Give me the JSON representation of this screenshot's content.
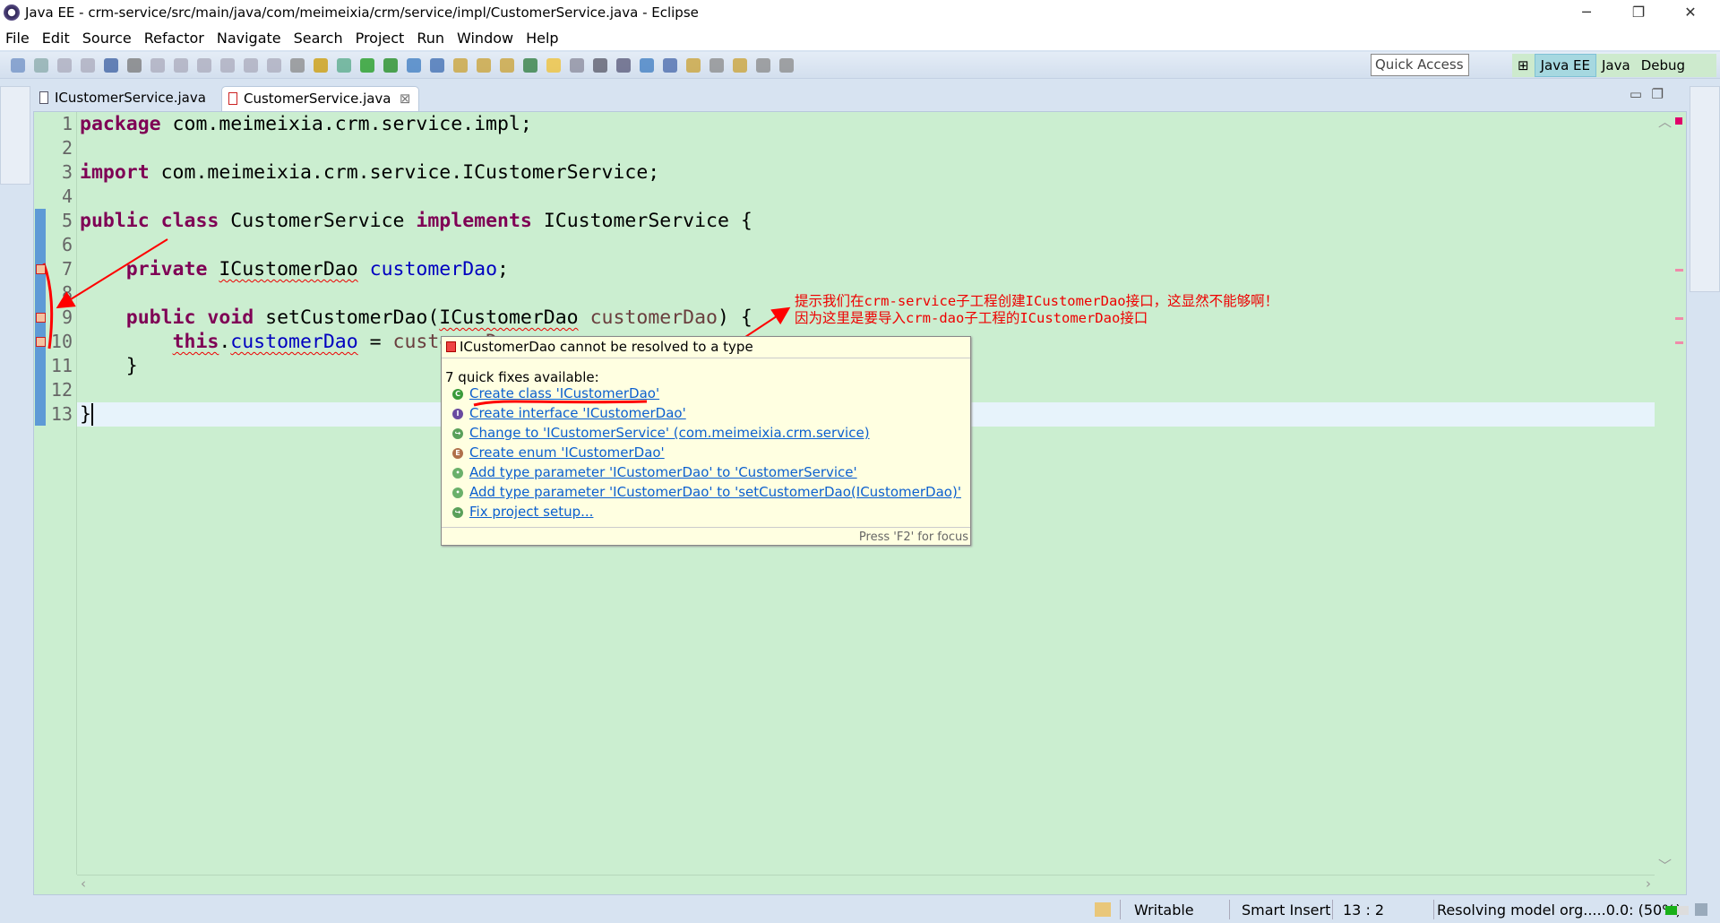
{
  "window": {
    "title": "Java EE - crm-service/src/main/java/com/meimeixia/crm/service/impl/CustomerService.java - Eclipse"
  },
  "menu": [
    "File",
    "Edit",
    "Source",
    "Refactor",
    "Navigate",
    "Search",
    "Project",
    "Run",
    "Window",
    "Help"
  ],
  "toolbar": {
    "quick_access_placeholder": "Quick Access"
  },
  "perspectives": [
    {
      "label": "Java EE",
      "active": true
    },
    {
      "label": "Java",
      "active": false
    },
    {
      "label": "Debug",
      "active": false
    }
  ],
  "tabs": [
    {
      "label": "ICustomerService.java",
      "active": false
    },
    {
      "label": "CustomerService.java",
      "active": true,
      "has_error": true
    }
  ],
  "editor": {
    "current_line": 13,
    "error_lines": [
      7,
      9,
      10
    ],
    "lines": [
      [
        [
          "package",
          "kw"
        ],
        [
          " com.meimeixia.crm.service.impl;",
          ""
        ]
      ],
      [],
      [
        [
          "import",
          "kw"
        ],
        [
          " com.meimeixia.crm.service.ICustomerService;",
          ""
        ]
      ],
      [],
      [
        [
          "public",
          "kw"
        ],
        [
          " ",
          ""
        ],
        [
          "class",
          "kw"
        ],
        [
          " CustomerService ",
          ""
        ],
        [
          "implements",
          "kw"
        ],
        [
          " ICustomerService {",
          ""
        ]
      ],
      [],
      [
        [
          "    ",
          ""
        ],
        [
          "private",
          "kw"
        ],
        [
          " ",
          ""
        ],
        [
          "ICustomerDao",
          "err"
        ],
        [
          " ",
          ""
        ],
        [
          "customerDao",
          "fld"
        ],
        [
          ";",
          ""
        ]
      ],
      [],
      [
        [
          "    ",
          ""
        ],
        [
          "public",
          "kw"
        ],
        [
          " ",
          ""
        ],
        [
          "void",
          "kw"
        ],
        [
          " setCustomerDao(",
          ""
        ],
        [
          "ICustomerDao",
          "err"
        ],
        [
          " ",
          ""
        ],
        [
          "customerDao",
          "par"
        ],
        [
          ") {",
          ""
        ]
      ],
      [
        [
          "        ",
          ""
        ],
        [
          "this",
          "kw err"
        ],
        [
          ".",
          ""
        ],
        [
          "customerDao",
          "fld err"
        ],
        [
          " = ",
          ""
        ],
        [
          "customerDao",
          "par"
        ],
        [
          ";",
          ""
        ]
      ],
      [
        [
          "    }",
          ""
        ]
      ],
      [],
      [
        [
          "}",
          ""
        ]
      ]
    ]
  },
  "hover": {
    "title": "ICustomerDao cannot be resolved to a type",
    "subtitle": "7 quick fixes available:",
    "fixes": [
      {
        "label": "Create class 'ICustomerDao'",
        "icon": "class-icon"
      },
      {
        "label": "Create interface 'ICustomerDao'",
        "icon": "interface-icon"
      },
      {
        "label": "Change to 'ICustomerService' (com.meimeixia.crm.service)",
        "icon": "change-icon"
      },
      {
        "label": "Create enum 'ICustomerDao'",
        "icon": "enum-icon"
      },
      {
        "label": "Add type parameter 'ICustomerDao' to 'CustomerService'",
        "icon": "type-param-icon"
      },
      {
        "label": "Add type parameter 'ICustomerDao' to 'setCustomerDao(ICustomerDao)'",
        "icon": "type-param-icon"
      },
      {
        "label": "Fix project setup...",
        "icon": "fix-icon"
      }
    ],
    "footer": "Press 'F2' for focus"
  },
  "annotation": {
    "line1": "提示我们在crm-service子工程创建ICustomerDao接口，这显然不能够啊！",
    "line2": "因为这里是要导入crm-dao子工程的ICustomerDao接口",
    "color": "#ff0000"
  },
  "status": {
    "writable": "Writable",
    "insert_mode": "Smart Insert",
    "position": "13 : 2",
    "progress_text": "Resolving model org.....0.0: (50%)",
    "progress_percent": 50
  },
  "colors": {
    "editor_bg": "#cbeed0",
    "keyword": "#7f0055",
    "field": "#0000c0",
    "link": "#0b5fcf"
  }
}
